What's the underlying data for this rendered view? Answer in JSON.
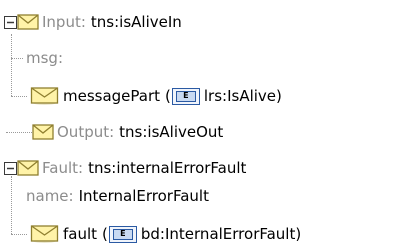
{
  "tree": {
    "input": {
      "label": "Input:",
      "value": "tns:isAliveIn",
      "msg_label": "msg:",
      "part": {
        "name": "messagePart",
        "open_paren": "(",
        "type": "lrs:IsAlive",
        "close_paren": ")"
      }
    },
    "output": {
      "label": "Output:",
      "value": "tns:isAliveOut"
    },
    "fault": {
      "label": "Fault:",
      "value": "tns:internalErrorFault",
      "name_label": "name:",
      "name_value": "InternalErrorFault",
      "part": {
        "name": "fault",
        "open_paren": "(",
        "type": "bd:InternalErrorFault",
        "close_paren": ")"
      }
    },
    "icons": {
      "expander": "collapse-minus-icon",
      "message": "envelope-icon",
      "element": "element-e-icon"
    },
    "colors": {
      "label_gray": "#8c8c8c",
      "envelope_fill": "#fff3a8",
      "envelope_stroke": "#8f7f2f",
      "element_blue": "#2b5aa3"
    }
  }
}
